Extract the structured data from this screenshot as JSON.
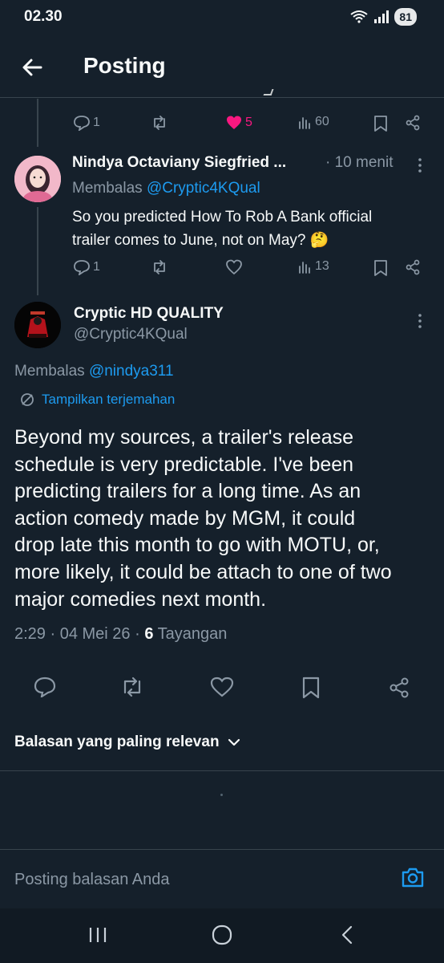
{
  "status": {
    "time": "02.30",
    "battery": "81"
  },
  "header": {
    "title": "Posting"
  },
  "first_post": {
    "counts": {
      "replies": "1",
      "reposts": "",
      "likes": "5",
      "views": "60"
    },
    "like_color": "#f91880"
  },
  "reply_post": {
    "name": "Nindya Octaviany Siegfried ...",
    "time": "· 10 menit",
    "replying_prefix": "Membalas",
    "replying_handle": "@Cryptic4KQual",
    "text_line1": "So you predicted How To Rob A Bank official",
    "text_line2": "trailer comes to June, not on May? 🤔",
    "counts": {
      "replies": "1",
      "reposts": "",
      "likes": "",
      "views": "13"
    }
  },
  "main_post": {
    "name": "Cryptic HD QUALITY",
    "handle": "@Cryptic4KQual",
    "replying_prefix": "Membalas",
    "replying_handle": "@nindya311",
    "translate_label": "Tampilkan terjemahan",
    "text_lines": [
      "Beyond my sources, a trailer's release",
      "schedule is very predictable. I've been",
      "predicting trailers for a long time. As an",
      "action comedy made by MGM, it could",
      "drop late this month to go with MOTU, or,",
      "more likely, it could be attach to one of two",
      "major comedies next month."
    ],
    "meta_time": "2:29 · 04 Mei 26 ·",
    "meta_views_count": "6",
    "meta_views_label": "Tayangan"
  },
  "sort_label": "Balasan yang paling relevan",
  "reply_bar": {
    "placeholder": "Posting balasan Anda"
  },
  "colors": {
    "background": "#15202b",
    "accent": "#1d9bf0",
    "muted": "#8b98a5",
    "divider": "#38444d"
  }
}
